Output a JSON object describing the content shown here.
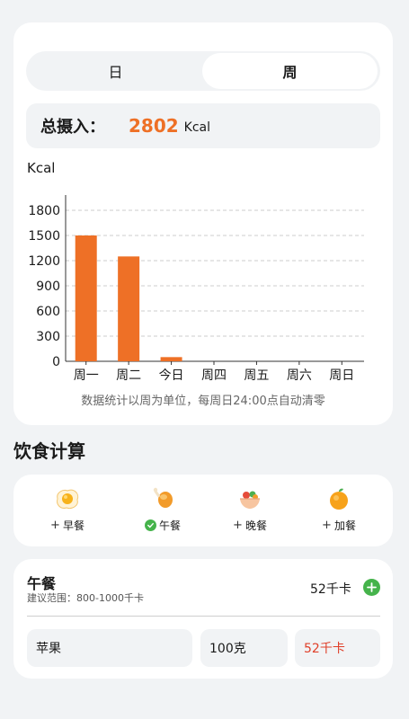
{
  "tabs": {
    "day": "日",
    "week": "周"
  },
  "summary": {
    "label": "总摄入：",
    "value": "2802",
    "unit": "Kcal"
  },
  "chart_data": {
    "type": "bar",
    "ylabel": "Kcal",
    "categories": [
      "周一",
      "周二",
      "今日",
      "周四",
      "周五",
      "周六",
      "周日"
    ],
    "values": [
      1500,
      1250,
      50,
      0,
      0,
      0,
      0
    ],
    "ylim": [
      0,
      1800
    ],
    "yticks": [
      0,
      300,
      600,
      900,
      1200,
      1500,
      1800
    ],
    "grid": true,
    "colors": {
      "bar": "#ee7026"
    }
  },
  "note": "数据统计以周为单位，每周日24:00点自动清零",
  "section_title": "饮食计算",
  "meals": [
    {
      "label": "早餐",
      "icon": "fried-egg-icon",
      "state": "add"
    },
    {
      "label": "午餐",
      "icon": "chicken-leg-icon",
      "state": "checked"
    },
    {
      "label": "晚餐",
      "icon": "salad-bowl-icon",
      "state": "add"
    },
    {
      "label": "加餐",
      "icon": "orange-icon",
      "state": "add"
    }
  ],
  "lunch": {
    "title": "午餐",
    "range": "建议范围：800-1000千卡",
    "kcal": "52千卡",
    "food": "苹果",
    "amount": "100克",
    "food_kcal": "52千卡"
  },
  "colors": {
    "accent": "#ee7026",
    "green": "#45b34b",
    "red": "#e0402a"
  }
}
